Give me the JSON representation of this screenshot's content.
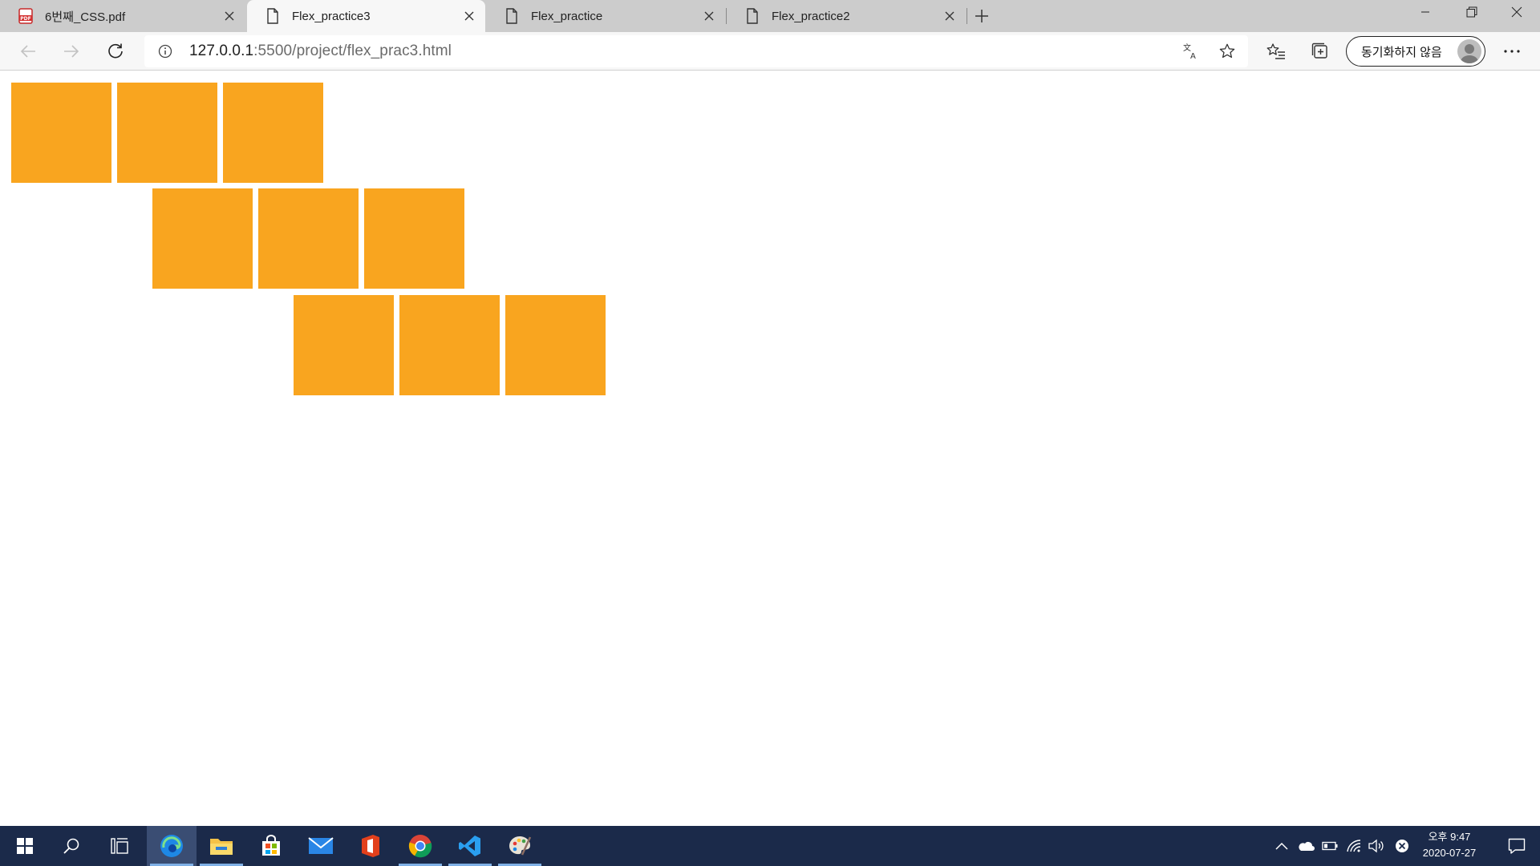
{
  "browser": {
    "tabs": [
      {
        "title": "6번째_CSS.pdf",
        "icon": "pdf-icon",
        "active": false
      },
      {
        "title": "Flex_practice3",
        "icon": "page-icon",
        "active": true
      },
      {
        "title": "Flex_practice",
        "icon": "page-icon",
        "active": false
      },
      {
        "title": "Flex_practice2",
        "icon": "page-icon",
        "active": false
      }
    ],
    "address": {
      "host": "127.0.0.1",
      "path": ":5500/project/flex_prac3.html"
    },
    "profile_label": "동기화하지 않음"
  },
  "page": {
    "box_color": "#f9a51f",
    "rows": [
      {
        "boxes": 3
      },
      {
        "boxes": 3
      },
      {
        "boxes": 3
      }
    ]
  },
  "taskbar": {
    "apps": [
      "start-icon",
      "search-icon",
      "task-view-icon",
      "edge-icon",
      "file-explorer-icon",
      "store-icon",
      "mail-icon",
      "office-icon",
      "chrome-icon",
      "vscode-icon",
      "paint-icon"
    ],
    "clock": {
      "time": "오후 9:47",
      "date": "2020-07-27"
    }
  }
}
